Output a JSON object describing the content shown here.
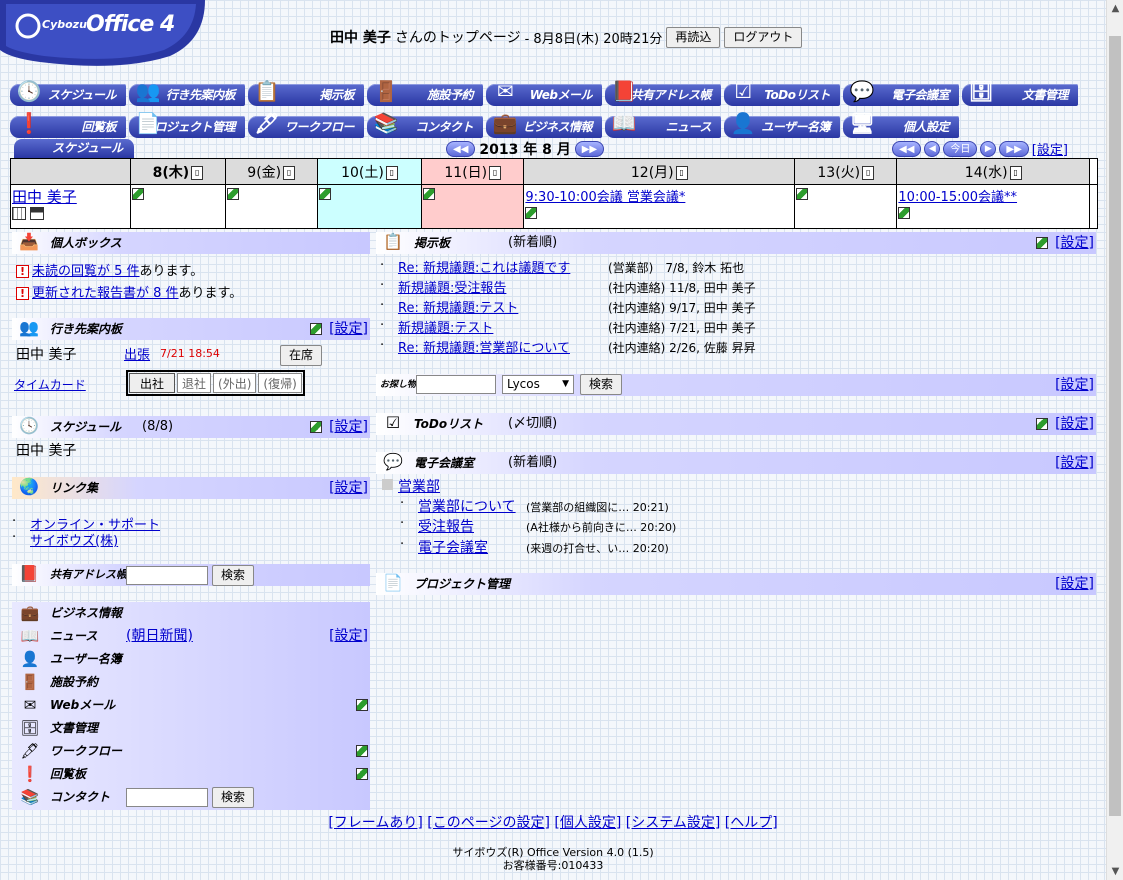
{
  "logo": {
    "brand": "Cybozu",
    "product": "Office 4"
  },
  "header": {
    "user_name": "田中 美子",
    "suffix": "さんのトップページ",
    "date_text": "- 8月8日(木) 20時21分",
    "reload_label": "再読込",
    "logout_label": "ログアウト"
  },
  "nav": {
    "row1": [
      "スケジュール",
      "行き先案内板",
      "掲示板",
      "施設予約",
      "Webメール",
      "共有アドレス帳",
      "ToDoリスト",
      "電子会議室",
      "文書管理"
    ],
    "row2": [
      "回覧板",
      "プロジェクト管理",
      "ワークフロー",
      "コンタクト",
      "ビジネス情報",
      "ニュース",
      "ユーザー名簿",
      "個人設定"
    ]
  },
  "schedule": {
    "tab_label": "スケジュール",
    "month_label": "2013 年 8 月",
    "today_label": "今日",
    "settings_label": "[設定]",
    "days": [
      "8(木)",
      "9(金)",
      "10(土)",
      "11(日)",
      "12(月)",
      "13(火)",
      "14(水)"
    ],
    "user": "田中 美子",
    "events": {
      "d4": "9:30-10:00会議 営業会議*",
      "d6": "10:00-15:00会議**"
    }
  },
  "personal_box": {
    "title": "個人ボックス",
    "line1_link": "未読の回覧が 5 件",
    "line1_suffix": "あります。",
    "line2_link": "更新された報告書が 8 件",
    "line2_suffix": "あります。"
  },
  "whereabouts": {
    "title": "行き先案内板",
    "settings": "[設定]",
    "name": "田中 美子",
    "status_link": "出張",
    "status_time": "7/21 18:54",
    "present_label": "在席",
    "timecard_link": "タイムカード",
    "tc_buttons": [
      "出社",
      "退社",
      "(外出)",
      "(復帰)"
    ]
  },
  "sched_panel": {
    "title": "スケジュール",
    "date": "(8/8)",
    "settings": "[設定]",
    "name": "田中 美子"
  },
  "links": {
    "title": "リンク集",
    "settings": "[設定]",
    "items": [
      "オンライン・サポート",
      "サイボウズ(株)"
    ]
  },
  "addressbook": {
    "title": "共有アドレス帳",
    "search_label": "検索"
  },
  "biz": {
    "items": [
      "ビジネス情報",
      "ニュース",
      "ユーザー名簿",
      "施設予約",
      "Webメール",
      "文書管理",
      "ワークフロー",
      "回覧板",
      "コンタクト"
    ],
    "news_link": "(朝日新聞)",
    "settings": "[設定]",
    "search_label": "検索"
  },
  "bulletin": {
    "title": "掲示板",
    "sub": "(新着順)",
    "settings": "[設定]",
    "posts": [
      {
        "title": "Re: 新規議題:これは議題です",
        "meta": "(営業部)　7/8, 鈴木 拓也"
      },
      {
        "title": "新規議題:受注報告",
        "meta": "(社内連絡) 11/8, 田中 美子"
      },
      {
        "title": "Re: 新規議題:テスト",
        "meta": "(社内連絡) 9/17, 田中 美子"
      },
      {
        "title": "新規議題:テスト",
        "meta": "(社内連絡) 7/21, 田中 美子"
      },
      {
        "title": "Re: 新規議題:営業部について",
        "meta": "(社内連絡) 2/26, 佐藤 昇昇"
      }
    ]
  },
  "search": {
    "title": "お探し物",
    "engine": "Lycos",
    "button": "検索",
    "settings": "[設定]"
  },
  "todo": {
    "title": "ToDoリスト",
    "sub": "(〆切順)",
    "settings": "[設定]"
  },
  "forum": {
    "title": "電子会議室",
    "sub": "(新着順)",
    "settings": "[設定]",
    "category": "営業部",
    "threads": [
      {
        "title": "営業部について",
        "meta": "(営業部の組織図に… 20:21)"
      },
      {
        "title": "受注報告",
        "meta": "(A社様から前向きに… 20:20)"
      },
      {
        "title": "電子会議室",
        "meta": "(来週の打合せ、い… 20:20)"
      }
    ]
  },
  "project": {
    "title": "プロジェクト管理",
    "settings": "[設定]"
  },
  "footer": {
    "links": [
      "[フレームあり]",
      "[このページの設定]",
      "[個人設定]",
      "[システム設定]",
      "[ヘルプ]"
    ],
    "copyright": "サイボウズ(R) Office Version 4.0 (1.5)",
    "customer_no": "お客様番号:010433"
  }
}
